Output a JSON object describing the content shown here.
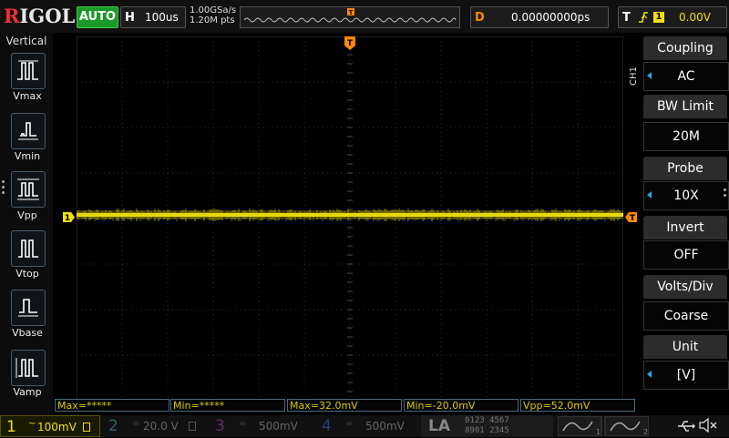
{
  "brand": "RIGOL",
  "run_status": "AUTO",
  "horizontal": {
    "letter": "H",
    "timebase": "100us"
  },
  "acquisition": {
    "sample_rate": "1.00GSa/s",
    "memory_depth": "1.20M pts"
  },
  "delay": {
    "letter": "D",
    "value": "0.00000000ps"
  },
  "trigger": {
    "letter": "T",
    "source": "1",
    "level": "0.00V"
  },
  "left_menu": {
    "title": "Vertical",
    "items": [
      {
        "label": "Vmax",
        "icon": "vmax-icon"
      },
      {
        "label": "Vmin",
        "icon": "vmin-icon"
      },
      {
        "label": "Vpp",
        "icon": "vpp-icon"
      },
      {
        "label": "Vtop",
        "icon": "vtop-icon"
      },
      {
        "label": "Vbase",
        "icon": "vbase-icon"
      },
      {
        "label": "Vamp",
        "icon": "vamp-icon"
      }
    ]
  },
  "right_menu": {
    "channel_tag": "CH1",
    "items": [
      {
        "title": "Coupling",
        "value": "AC",
        "selectable": true
      },
      {
        "title": "BW Limit",
        "value": "20M",
        "selectable": false
      },
      {
        "title": "Probe",
        "value": "10X",
        "selectable": true
      },
      {
        "title": "Invert",
        "value": "OFF",
        "selectable": false
      },
      {
        "title": "Volts/Div",
        "value": "Coarse",
        "selectable": false
      },
      {
        "title": "Unit",
        "value": "[V]",
        "selectable": true
      }
    ]
  },
  "waveform_marker": {
    "channel": "1",
    "trigger_mark": "T"
  },
  "measurements": [
    "Max=*****",
    "Min=*****",
    "Max=32.0mV",
    "Min=-20.0mV",
    "Vpp=52.0mV"
  ],
  "channels": [
    {
      "num": "1",
      "scale": "100mV",
      "color": "#f0e010",
      "active": true
    },
    {
      "num": "2",
      "scale": "20.0 V",
      "color": "#30d0d0",
      "active": false
    },
    {
      "num": "3",
      "scale": "500mV",
      "color": "#d040d0",
      "active": false
    },
    {
      "num": "4",
      "scale": "500mV",
      "color": "#4070ff",
      "active": false
    }
  ],
  "la": {
    "label": "LA",
    "digits_top": "0123 4567",
    "digits_bottom": "8901 2345"
  },
  "colors": {
    "ch1": "#f0e010",
    "trigger": "#ff8800",
    "accent": "#2aa8e0",
    "auto": "#1a9a2a"
  }
}
